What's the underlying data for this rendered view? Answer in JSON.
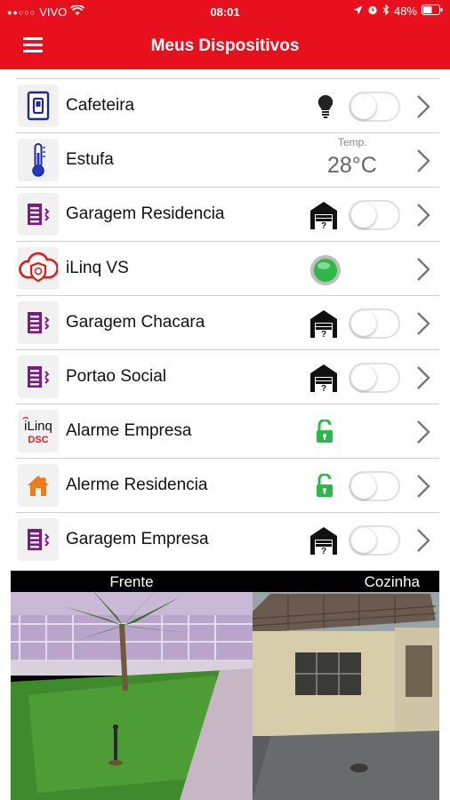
{
  "status": {
    "carrier": "VIVO",
    "time": "08:01",
    "battery": "48%"
  },
  "nav": {
    "title": "Meus Dispositivos",
    "menu_icon": "menu-icon"
  },
  "devices": [
    {
      "name": "Cafeteira",
      "icon": "switch-icon",
      "status": "bulb",
      "toggle": true
    },
    {
      "name": "Estufa",
      "icon": "thermometer-icon",
      "status": "temp",
      "temp_caption": "Temp.",
      "temp_value": "28°C"
    },
    {
      "name": "Garagem Residencia",
      "icon": "gate-icon",
      "status": "garage",
      "toggle": true
    },
    {
      "name": "iLinq VS",
      "icon": "ilinq-vs-icon",
      "status": "led"
    },
    {
      "name": "Garagem Chacara",
      "icon": "gate-icon",
      "status": "garage",
      "toggle": true
    },
    {
      "name": "Portao Social",
      "icon": "gate-icon",
      "status": "garage",
      "toggle": true
    },
    {
      "name": "Alarme Empresa",
      "icon": "ilinq-dsc-icon",
      "status": "lock"
    },
    {
      "name": "Alerme Residencia",
      "icon": "home-alarm-icon",
      "status": "lock",
      "toggle": true
    },
    {
      "name": "Garagem Empresa",
      "icon": "gate-icon",
      "status": "garage",
      "toggle": true
    }
  ],
  "cameras": [
    {
      "label": "Frente"
    },
    {
      "label": "Cozinha"
    }
  ],
  "colors": {
    "brand": "#e8101c",
    "purple": "#7b1a87",
    "green": "#2db84a"
  }
}
